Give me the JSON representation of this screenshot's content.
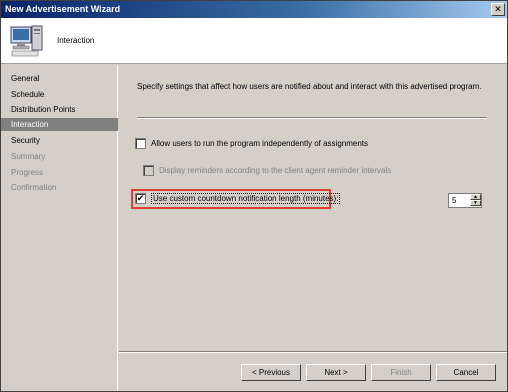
{
  "window": {
    "title": "New Advertisement Wizard",
    "close_label": "✕"
  },
  "header": {
    "title": "Interaction",
    "icon": "computer-icon"
  },
  "sidebar": {
    "items": [
      {
        "label": "General",
        "state": "normal"
      },
      {
        "label": "Schedule",
        "state": "normal"
      },
      {
        "label": "Distribution Points",
        "state": "normal"
      },
      {
        "label": "Interaction",
        "state": "active"
      },
      {
        "label": "Security",
        "state": "normal"
      },
      {
        "label": "Summary",
        "state": "disabled"
      },
      {
        "label": "Progress",
        "state": "disabled"
      },
      {
        "label": "Confirmation",
        "state": "disabled"
      }
    ]
  },
  "content": {
    "description": "Specify settings that affect how users are notified about and interact with this advertised program.",
    "options": {
      "allow_users": {
        "label": "Allow users to run the program independently of assignments",
        "checked": false,
        "enabled": true
      },
      "display_reminders": {
        "label": "Display reminders according to the client agent reminder intervals",
        "checked": false,
        "enabled": false
      },
      "custom_countdown": {
        "label": "Use custom countdown notification length (minutes):",
        "checked": true,
        "enabled": true,
        "check_mark": "✔"
      }
    },
    "countdown_minutes": "5",
    "highlight_color": "#e03c3c"
  },
  "buttons": {
    "previous": "< Previous",
    "next": "Next >",
    "finish": "Finish",
    "cancel": "Cancel"
  }
}
